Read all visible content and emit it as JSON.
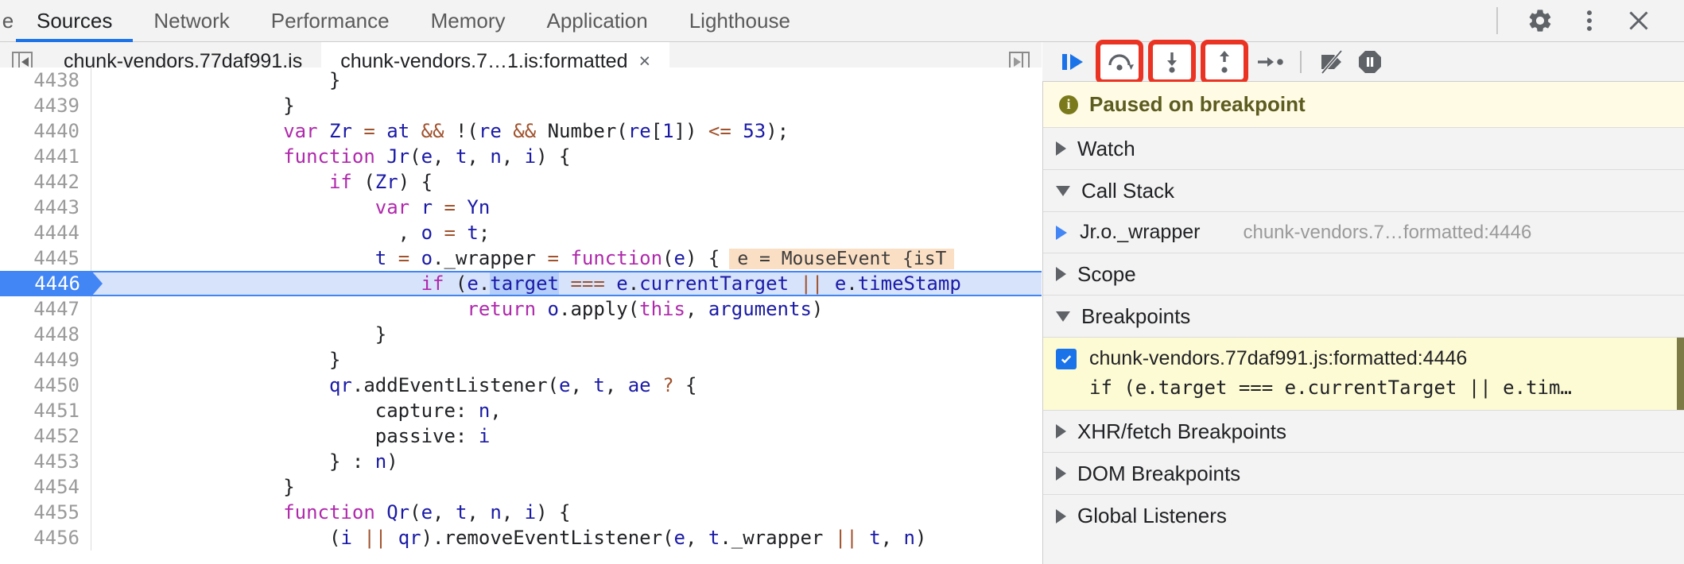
{
  "window": {
    "panel_tabs": [
      {
        "label": "e",
        "selected": false,
        "clipped": true
      },
      {
        "label": "Sources",
        "selected": true,
        "clipped": false
      },
      {
        "label": "Network",
        "selected": false,
        "clipped": false
      },
      {
        "label": "Performance",
        "selected": false,
        "clipped": false
      },
      {
        "label": "Memory",
        "selected": false,
        "clipped": false
      },
      {
        "label": "Application",
        "selected": false,
        "clipped": false
      },
      {
        "label": "Lighthouse",
        "selected": false,
        "clipped": false
      }
    ],
    "toolbar_icons": [
      {
        "name": "gear-icon",
        "title": "Settings"
      },
      {
        "name": "more-vertical-icon",
        "title": "Customize and control DevTools"
      },
      {
        "name": "close-icon",
        "title": "Close DevTools"
      }
    ]
  },
  "file_tabs": {
    "scroll_left_label": "scroll-tabs-left",
    "scroll_right_label": "scroll-tabs-right",
    "tabs": [
      {
        "label": "chunk-vendors.77daf991.js",
        "active": false,
        "closable": false
      },
      {
        "label": "chunk-vendors.7…1.js:formatted",
        "active": true,
        "closable": true,
        "close_glyph": "×"
      }
    ]
  },
  "debug_toolbar": {
    "buttons": [
      {
        "name": "resume-script-execution-button",
        "title": "Resume script execution",
        "highlighted": false
      },
      {
        "name": "step-over-next-function-call-button",
        "title": "Step over next function call",
        "highlighted": true
      },
      {
        "name": "step-into-next-function-call-button",
        "title": "Step into next function call",
        "highlighted": true
      },
      {
        "name": "step-out-of-current-function-button",
        "title": "Step out of current function",
        "highlighted": true
      },
      {
        "name": "step-button",
        "title": "Step",
        "highlighted": false
      },
      {
        "name": "deactivate-breakpoints-button",
        "title": "Deactivate breakpoints",
        "highlighted": false
      },
      {
        "name": "pause-on-exceptions-button",
        "title": "Pause on exceptions",
        "highlighted": false
      }
    ],
    "highlight_color": "#ea3323"
  },
  "editor": {
    "current_line": 4446,
    "inline_hint": "e = MouseEvent {isT",
    "selected_token": "target",
    "lines": [
      {
        "num": "4438",
        "tokens": [
          {
            "t": "                    }",
            "c": "pln"
          }
        ],
        "clipped_top": true
      },
      {
        "num": "4439",
        "tokens": [
          {
            "t": "                }",
            "c": "pln"
          }
        ]
      },
      {
        "num": "4440",
        "tokens": [
          {
            "t": "                ",
            "c": "pln"
          },
          {
            "t": "var",
            "c": "kw"
          },
          {
            "t": " ",
            "c": "pln"
          },
          {
            "t": "Zr",
            "c": "id"
          },
          {
            "t": " ",
            "c": "pln"
          },
          {
            "t": "=",
            "c": "op"
          },
          {
            "t": " ",
            "c": "pln"
          },
          {
            "t": "at",
            "c": "id"
          },
          {
            "t": " ",
            "c": "pln"
          },
          {
            "t": "&&",
            "c": "op"
          },
          {
            "t": " !(",
            "c": "pln"
          },
          {
            "t": "re",
            "c": "id"
          },
          {
            "t": " ",
            "c": "pln"
          },
          {
            "t": "&&",
            "c": "op"
          },
          {
            "t": " Number(",
            "c": "pln"
          },
          {
            "t": "re",
            "c": "id"
          },
          {
            "t": "[",
            "c": "pln"
          },
          {
            "t": "1",
            "c": "num"
          },
          {
            "t": "]) ",
            "c": "pln"
          },
          {
            "t": "<=",
            "c": "op"
          },
          {
            "t": " ",
            "c": "pln"
          },
          {
            "t": "53",
            "c": "num"
          },
          {
            "t": ");",
            "c": "pln"
          }
        ]
      },
      {
        "num": "4441",
        "tokens": [
          {
            "t": "                ",
            "c": "pln"
          },
          {
            "t": "function",
            "c": "kw"
          },
          {
            "t": " ",
            "c": "pln"
          },
          {
            "t": "Jr",
            "c": "id"
          },
          {
            "t": "(",
            "c": "pln"
          },
          {
            "t": "e",
            "c": "id"
          },
          {
            "t": ", ",
            "c": "pln"
          },
          {
            "t": "t",
            "c": "id"
          },
          {
            "t": ", ",
            "c": "pln"
          },
          {
            "t": "n",
            "c": "id"
          },
          {
            "t": ", ",
            "c": "pln"
          },
          {
            "t": "i",
            "c": "id"
          },
          {
            "t": ") {",
            "c": "pln"
          }
        ]
      },
      {
        "num": "4442",
        "tokens": [
          {
            "t": "                    ",
            "c": "pln"
          },
          {
            "t": "if",
            "c": "kw"
          },
          {
            "t": " (",
            "c": "pln"
          },
          {
            "t": "Zr",
            "c": "id"
          },
          {
            "t": ") {",
            "c": "pln"
          }
        ]
      },
      {
        "num": "4443",
        "tokens": [
          {
            "t": "                        ",
            "c": "pln"
          },
          {
            "t": "var",
            "c": "kw"
          },
          {
            "t": " ",
            "c": "pln"
          },
          {
            "t": "r",
            "c": "id"
          },
          {
            "t": " ",
            "c": "pln"
          },
          {
            "t": "=",
            "c": "op"
          },
          {
            "t": " ",
            "c": "pln"
          },
          {
            "t": "Yn",
            "c": "id"
          }
        ]
      },
      {
        "num": "4444",
        "tokens": [
          {
            "t": "                          , ",
            "c": "pln"
          },
          {
            "t": "o",
            "c": "id"
          },
          {
            "t": " ",
            "c": "pln"
          },
          {
            "t": "=",
            "c": "op"
          },
          {
            "t": " ",
            "c": "pln"
          },
          {
            "t": "t",
            "c": "id"
          },
          {
            "t": ";",
            "c": "pln"
          }
        ]
      },
      {
        "num": "4445",
        "tokens": [
          {
            "t": "                        ",
            "c": "pln"
          },
          {
            "t": "t",
            "c": "id"
          },
          {
            "t": " ",
            "c": "pln"
          },
          {
            "t": "=",
            "c": "op"
          },
          {
            "t": " ",
            "c": "pln"
          },
          {
            "t": "o",
            "c": "id"
          },
          {
            "t": ".",
            "c": "pln"
          },
          {
            "t": "_wrapper",
            "c": "pln"
          },
          {
            "t": " ",
            "c": "pln"
          },
          {
            "t": "=",
            "c": "op"
          },
          {
            "t": " ",
            "c": "pln"
          },
          {
            "t": "function",
            "c": "kw"
          },
          {
            "t": "(",
            "c": "pln"
          },
          {
            "t": "e",
            "c": "id"
          },
          {
            "t": ") {",
            "c": "pln"
          }
        ],
        "hint": true
      },
      {
        "num": "4446",
        "current": true,
        "tokens": [
          {
            "t": "                            ",
            "c": "pln"
          },
          {
            "t": "if",
            "c": "kw"
          },
          {
            "t": " (",
            "c": "pln"
          },
          {
            "t": "e",
            "c": "id"
          },
          {
            "t": ".",
            "c": "pln"
          },
          {
            "t": "target",
            "c": "sel"
          },
          {
            "t": " ",
            "c": "pln"
          },
          {
            "t": "===",
            "c": "op"
          },
          {
            "t": " ",
            "c": "pln"
          },
          {
            "t": "e",
            "c": "id"
          },
          {
            "t": ".",
            "c": "pln"
          },
          {
            "t": "currentTarget",
            "c": "id"
          },
          {
            "t": " ",
            "c": "pln"
          },
          {
            "t": "||",
            "c": "op"
          },
          {
            "t": " ",
            "c": "pln"
          },
          {
            "t": "e",
            "c": "id"
          },
          {
            "t": ".",
            "c": "pln"
          },
          {
            "t": "timeStamp",
            "c": "id"
          }
        ]
      },
      {
        "num": "4447",
        "tokens": [
          {
            "t": "                                ",
            "c": "pln"
          },
          {
            "t": "return",
            "c": "kw"
          },
          {
            "t": " ",
            "c": "pln"
          },
          {
            "t": "o",
            "c": "id"
          },
          {
            "t": ".",
            "c": "pln"
          },
          {
            "t": "apply",
            "c": "pln"
          },
          {
            "t": "(",
            "c": "pln"
          },
          {
            "t": "this",
            "c": "kw"
          },
          {
            "t": ", ",
            "c": "pln"
          },
          {
            "t": "arguments",
            "c": "id"
          },
          {
            "t": ")",
            "c": "pln"
          }
        ]
      },
      {
        "num": "4448",
        "tokens": [
          {
            "t": "                        }",
            "c": "pln"
          }
        ]
      },
      {
        "num": "4449",
        "tokens": [
          {
            "t": "                    }",
            "c": "pln"
          }
        ]
      },
      {
        "num": "4450",
        "tokens": [
          {
            "t": "                    ",
            "c": "pln"
          },
          {
            "t": "qr",
            "c": "id"
          },
          {
            "t": ".",
            "c": "pln"
          },
          {
            "t": "addEventListener",
            "c": "pln"
          },
          {
            "t": "(",
            "c": "pln"
          },
          {
            "t": "e",
            "c": "id"
          },
          {
            "t": ", ",
            "c": "pln"
          },
          {
            "t": "t",
            "c": "id"
          },
          {
            "t": ", ",
            "c": "pln"
          },
          {
            "t": "ae",
            "c": "id"
          },
          {
            "t": " ",
            "c": "pln"
          },
          {
            "t": "?",
            "c": "op"
          },
          {
            "t": " {",
            "c": "pln"
          }
        ]
      },
      {
        "num": "4451",
        "tokens": [
          {
            "t": "                        capture: ",
            "c": "pln"
          },
          {
            "t": "n",
            "c": "id"
          },
          {
            "t": ",",
            "c": "pln"
          }
        ]
      },
      {
        "num": "4452",
        "tokens": [
          {
            "t": "                        passive: ",
            "c": "pln"
          },
          {
            "t": "i",
            "c": "id"
          }
        ]
      },
      {
        "num": "4453",
        "tokens": [
          {
            "t": "                    } : ",
            "c": "pln"
          },
          {
            "t": "n",
            "c": "id"
          },
          {
            "t": ")",
            "c": "pln"
          }
        ]
      },
      {
        "num": "4454",
        "tokens": [
          {
            "t": "                }",
            "c": "pln"
          }
        ]
      },
      {
        "num": "4455",
        "tokens": [
          {
            "t": "                ",
            "c": "pln"
          },
          {
            "t": "function",
            "c": "kw"
          },
          {
            "t": " ",
            "c": "pln"
          },
          {
            "t": "Qr",
            "c": "id"
          },
          {
            "t": "(",
            "c": "pln"
          },
          {
            "t": "e",
            "c": "id"
          },
          {
            "t": ", ",
            "c": "pln"
          },
          {
            "t": "t",
            "c": "id"
          },
          {
            "t": ", ",
            "c": "pln"
          },
          {
            "t": "n",
            "c": "id"
          },
          {
            "t": ", ",
            "c": "pln"
          },
          {
            "t": "i",
            "c": "id"
          },
          {
            "t": ") {",
            "c": "pln"
          }
        ]
      },
      {
        "num": "4456",
        "clipped_bottom": true,
        "tokens": [
          {
            "t": "                    (",
            "c": "pln"
          },
          {
            "t": "i",
            "c": "id"
          },
          {
            "t": " ",
            "c": "pln"
          },
          {
            "t": "||",
            "c": "op"
          },
          {
            "t": " ",
            "c": "pln"
          },
          {
            "t": "qr",
            "c": "id"
          },
          {
            "t": ").",
            "c": "pln"
          },
          {
            "t": "removeEventListener",
            "c": "pln"
          },
          {
            "t": "(",
            "c": "pln"
          },
          {
            "t": "e",
            "c": "id"
          },
          {
            "t": ", ",
            "c": "pln"
          },
          {
            "t": "t",
            "c": "id"
          },
          {
            "t": ".",
            "c": "pln"
          },
          {
            "t": "_wrapper",
            "c": "pln"
          },
          {
            "t": " ",
            "c": "pln"
          },
          {
            "t": "||",
            "c": "op"
          },
          {
            "t": " ",
            "c": "pln"
          },
          {
            "t": "t",
            "c": "id"
          },
          {
            "t": ", ",
            "c": "pln"
          },
          {
            "t": "n",
            "c": "id"
          },
          {
            "t": ")",
            "c": "pln"
          }
        ]
      }
    ]
  },
  "sidebar": {
    "paused_banner": {
      "text": "Paused on breakpoint",
      "icon": "info-icon"
    },
    "watch": {
      "label": "Watch",
      "expanded": false
    },
    "call_stack": {
      "label": "Call Stack",
      "expanded": true,
      "frames": [
        {
          "name": "Jr.o._wrapper",
          "location": "chunk-vendors.7…formatted:4446",
          "selected": true
        }
      ]
    },
    "scope": {
      "label": "Scope",
      "expanded": false
    },
    "breakpoints": {
      "label": "Breakpoints",
      "expanded": true,
      "items": [
        {
          "checked": true,
          "title": "chunk-vendors.77daf991.js:formatted:4446",
          "snippet": "if (e.target === e.currentTarget || e.tim…"
        }
      ]
    },
    "xhr_breakpoints": {
      "label": "XHR/fetch Breakpoints",
      "expanded": false
    },
    "dom_breakpoints": {
      "label": "DOM Breakpoints",
      "expanded": false
    },
    "global_listeners": {
      "label": "Global Listeners",
      "expanded": false
    }
  }
}
